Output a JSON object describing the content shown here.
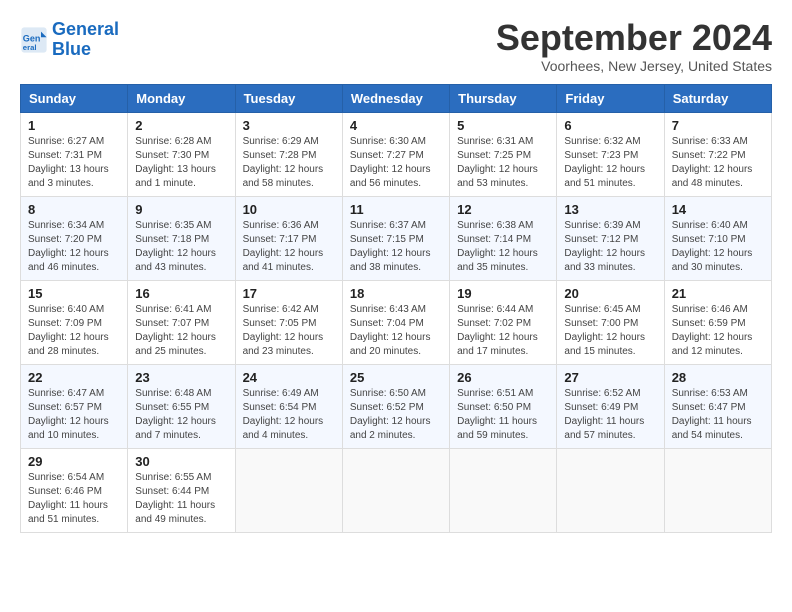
{
  "logo": {
    "line1": "General",
    "line2": "Blue"
  },
  "title": "September 2024",
  "location": "Voorhees, New Jersey, United States",
  "headers": [
    "Sunday",
    "Monday",
    "Tuesday",
    "Wednesday",
    "Thursday",
    "Friday",
    "Saturday"
  ],
  "weeks": [
    [
      {
        "day": "1",
        "sunrise": "Sunrise: 6:27 AM",
        "sunset": "Sunset: 7:31 PM",
        "daylight": "Daylight: 13 hours and 3 minutes."
      },
      {
        "day": "2",
        "sunrise": "Sunrise: 6:28 AM",
        "sunset": "Sunset: 7:30 PM",
        "daylight": "Daylight: 13 hours and 1 minute."
      },
      {
        "day": "3",
        "sunrise": "Sunrise: 6:29 AM",
        "sunset": "Sunset: 7:28 PM",
        "daylight": "Daylight: 12 hours and 58 minutes."
      },
      {
        "day": "4",
        "sunrise": "Sunrise: 6:30 AM",
        "sunset": "Sunset: 7:27 PM",
        "daylight": "Daylight: 12 hours and 56 minutes."
      },
      {
        "day": "5",
        "sunrise": "Sunrise: 6:31 AM",
        "sunset": "Sunset: 7:25 PM",
        "daylight": "Daylight: 12 hours and 53 minutes."
      },
      {
        "day": "6",
        "sunrise": "Sunrise: 6:32 AM",
        "sunset": "Sunset: 7:23 PM",
        "daylight": "Daylight: 12 hours and 51 minutes."
      },
      {
        "day": "7",
        "sunrise": "Sunrise: 6:33 AM",
        "sunset": "Sunset: 7:22 PM",
        "daylight": "Daylight: 12 hours and 48 minutes."
      }
    ],
    [
      {
        "day": "8",
        "sunrise": "Sunrise: 6:34 AM",
        "sunset": "Sunset: 7:20 PM",
        "daylight": "Daylight: 12 hours and 46 minutes."
      },
      {
        "day": "9",
        "sunrise": "Sunrise: 6:35 AM",
        "sunset": "Sunset: 7:18 PM",
        "daylight": "Daylight: 12 hours and 43 minutes."
      },
      {
        "day": "10",
        "sunrise": "Sunrise: 6:36 AM",
        "sunset": "Sunset: 7:17 PM",
        "daylight": "Daylight: 12 hours and 41 minutes."
      },
      {
        "day": "11",
        "sunrise": "Sunrise: 6:37 AM",
        "sunset": "Sunset: 7:15 PM",
        "daylight": "Daylight: 12 hours and 38 minutes."
      },
      {
        "day": "12",
        "sunrise": "Sunrise: 6:38 AM",
        "sunset": "Sunset: 7:14 PM",
        "daylight": "Daylight: 12 hours and 35 minutes."
      },
      {
        "day": "13",
        "sunrise": "Sunrise: 6:39 AM",
        "sunset": "Sunset: 7:12 PM",
        "daylight": "Daylight: 12 hours and 33 minutes."
      },
      {
        "day": "14",
        "sunrise": "Sunrise: 6:40 AM",
        "sunset": "Sunset: 7:10 PM",
        "daylight": "Daylight: 12 hours and 30 minutes."
      }
    ],
    [
      {
        "day": "15",
        "sunrise": "Sunrise: 6:40 AM",
        "sunset": "Sunset: 7:09 PM",
        "daylight": "Daylight: 12 hours and 28 minutes."
      },
      {
        "day": "16",
        "sunrise": "Sunrise: 6:41 AM",
        "sunset": "Sunset: 7:07 PM",
        "daylight": "Daylight: 12 hours and 25 minutes."
      },
      {
        "day": "17",
        "sunrise": "Sunrise: 6:42 AM",
        "sunset": "Sunset: 7:05 PM",
        "daylight": "Daylight: 12 hours and 23 minutes."
      },
      {
        "day": "18",
        "sunrise": "Sunrise: 6:43 AM",
        "sunset": "Sunset: 7:04 PM",
        "daylight": "Daylight: 12 hours and 20 minutes."
      },
      {
        "day": "19",
        "sunrise": "Sunrise: 6:44 AM",
        "sunset": "Sunset: 7:02 PM",
        "daylight": "Daylight: 12 hours and 17 minutes."
      },
      {
        "day": "20",
        "sunrise": "Sunrise: 6:45 AM",
        "sunset": "Sunset: 7:00 PM",
        "daylight": "Daylight: 12 hours and 15 minutes."
      },
      {
        "day": "21",
        "sunrise": "Sunrise: 6:46 AM",
        "sunset": "Sunset: 6:59 PM",
        "daylight": "Daylight: 12 hours and 12 minutes."
      }
    ],
    [
      {
        "day": "22",
        "sunrise": "Sunrise: 6:47 AM",
        "sunset": "Sunset: 6:57 PM",
        "daylight": "Daylight: 12 hours and 10 minutes."
      },
      {
        "day": "23",
        "sunrise": "Sunrise: 6:48 AM",
        "sunset": "Sunset: 6:55 PM",
        "daylight": "Daylight: 12 hours and 7 minutes."
      },
      {
        "day": "24",
        "sunrise": "Sunrise: 6:49 AM",
        "sunset": "Sunset: 6:54 PM",
        "daylight": "Daylight: 12 hours and 4 minutes."
      },
      {
        "day": "25",
        "sunrise": "Sunrise: 6:50 AM",
        "sunset": "Sunset: 6:52 PM",
        "daylight": "Daylight: 12 hours and 2 minutes."
      },
      {
        "day": "26",
        "sunrise": "Sunrise: 6:51 AM",
        "sunset": "Sunset: 6:50 PM",
        "daylight": "Daylight: 11 hours and 59 minutes."
      },
      {
        "day": "27",
        "sunrise": "Sunrise: 6:52 AM",
        "sunset": "Sunset: 6:49 PM",
        "daylight": "Daylight: 11 hours and 57 minutes."
      },
      {
        "day": "28",
        "sunrise": "Sunrise: 6:53 AM",
        "sunset": "Sunset: 6:47 PM",
        "daylight": "Daylight: 11 hours and 54 minutes."
      }
    ],
    [
      {
        "day": "29",
        "sunrise": "Sunrise: 6:54 AM",
        "sunset": "Sunset: 6:46 PM",
        "daylight": "Daylight: 11 hours and 51 minutes."
      },
      {
        "day": "30",
        "sunrise": "Sunrise: 6:55 AM",
        "sunset": "Sunset: 6:44 PM",
        "daylight": "Daylight: 11 hours and 49 minutes."
      },
      null,
      null,
      null,
      null,
      null
    ]
  ]
}
